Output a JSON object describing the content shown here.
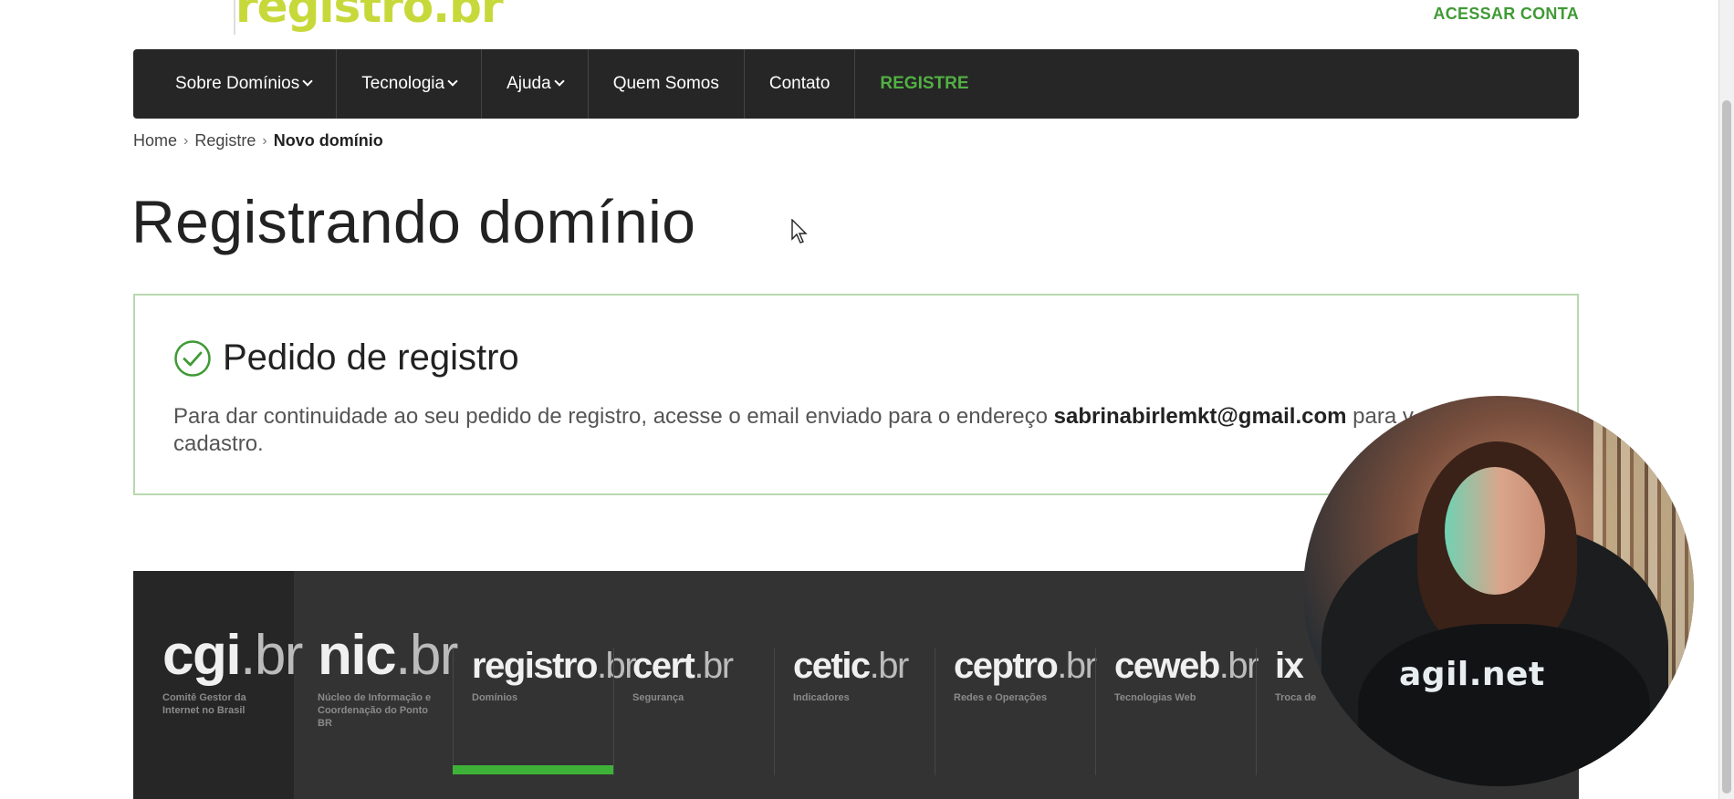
{
  "header": {
    "logo_text": "registro.br",
    "account_link": "ACESSAR CONTA"
  },
  "nav": {
    "items": [
      {
        "label": "Sobre Domínios",
        "dropdown": true
      },
      {
        "label": "Tecnologia",
        "dropdown": true
      },
      {
        "label": "Ajuda",
        "dropdown": true
      },
      {
        "label": "Quem Somos",
        "dropdown": false
      },
      {
        "label": "Contato",
        "dropdown": false
      },
      {
        "label": "REGISTRE",
        "dropdown": false,
        "highlight": true
      }
    ]
  },
  "breadcrumb": {
    "home": "Home",
    "parent": "Registre",
    "current": "Novo domínio"
  },
  "page_title": "Registrando domínio",
  "notice": {
    "title": "Pedido de registro",
    "message_before": "Para dar continuidade ao seu pedido de registro, acesse o email enviado para o endereço",
    "email": "sabrinabirlemkt@gmail.com",
    "message_after": "para v",
    "message_end": "cadastro."
  },
  "footer": {
    "brands": [
      {
        "name": "cgi",
        "suffix": ".br",
        "sub": "Comitê Gestor da Internet no Brasil"
      },
      {
        "name": "nic",
        "suffix": ".br",
        "sub": "Núcleo de Informação e Coordenação do Ponto BR"
      },
      {
        "name": "registro",
        "suffix": ".br",
        "sub": "Domínios"
      },
      {
        "name": "cert",
        "suffix": ".br",
        "sub": "Segurança"
      },
      {
        "name": "cetic",
        "suffix": ".br",
        "sub": "Indicadores"
      },
      {
        "name": "ceptro",
        "suffix": ".br",
        "sub": "Redes e Operações"
      },
      {
        "name": "ceweb",
        "suffix": ".br",
        "sub": "Tecnologias Web"
      },
      {
        "name": "ix",
        "suffix": "",
        "sub": "Troca de"
      }
    ],
    "active_index": 2,
    "accent_color": "#3eb238"
  },
  "video_overlay": {
    "shirt_text": "agil.net"
  },
  "colors": {
    "accent_green": "#3f9a35",
    "nav_bg": "#262626",
    "notice_border": "#b8d8b0"
  }
}
